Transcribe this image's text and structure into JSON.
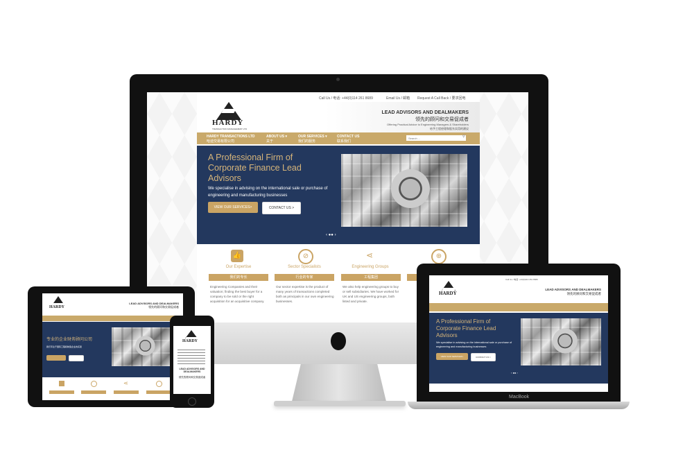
{
  "site": {
    "contact_line": "Call Us / 电话: +44(0)114 261 8689",
    "email_link": "Email Us / 邮箱",
    "callback_link": "Request A Call Back / 要求回电",
    "brand": "HARDY",
    "brand_sub": "TRANSACTION MANAGEMENT LTD",
    "tagline_en": "LEAD ADVISORS AND DEALMAKERS",
    "tagline_cn": "领先的顾问和交易促成者",
    "subtag_en": "Offering Practical Advice to Engineering Managers & Shareholders",
    "subtag_cn": "给予工程经理和股东实用的建议",
    "nav": [
      {
        "en": "HARDY TRANSACTIONS LTD",
        "cn": "哈迪交易有限公司"
      },
      {
        "en": "ABOUT US ▾",
        "cn": "关于"
      },
      {
        "en": "OUR SERVICES ▾",
        "cn": "我们的服务"
      },
      {
        "en": "CONTACT US",
        "cn": "联系我们"
      }
    ],
    "search_placeholder": "Search ...",
    "hero_title": "A Professional Firm of Corporate Finance Lead Advisors",
    "hero_text": "We specialise in advising on the international sale or purchase of engineering and manufacturing businesses",
    "hero_title_cn": "专业的企业财务顾问公司",
    "hero_text_cn": "我们专注于国际工程和制造企业的买卖",
    "btn_services": "VIEW OUR SERVICES>",
    "btn_contact": "CONTACT US >",
    "slider_dots": "‹ ●● ›",
    "features": [
      {
        "icon": "👍",
        "title": "Our Expertise",
        "cn": "我们的专长",
        "text": "Engineering Companies and their valuation; finding the best buyer for a company to be sold or the right acquisition for an acquisitive company."
      },
      {
        "icon": "⊘",
        "title": "Sector Specialists",
        "cn": "行业的专家",
        "text": "Our sector expertise is the product of many years of transactions completed both as principals in our own engineering businesses."
      },
      {
        "icon": "⋖",
        "title": "Engineering Groups",
        "cn": "工程集团",
        "text": "We also help engineering groups to buy or sell subsidiaries. We have worked for UK and US engineering groups, both listed and private."
      },
      {
        "icon": "⊕",
        "title": "",
        "cn": "",
        "text": ""
      }
    ]
  },
  "devices": {
    "laptop_label": "MacBook",
    "imac_logo": ""
  },
  "colors": {
    "navy": "#23385e",
    "gold": "#caa464",
    "nav_gold": "#c9a96a"
  }
}
